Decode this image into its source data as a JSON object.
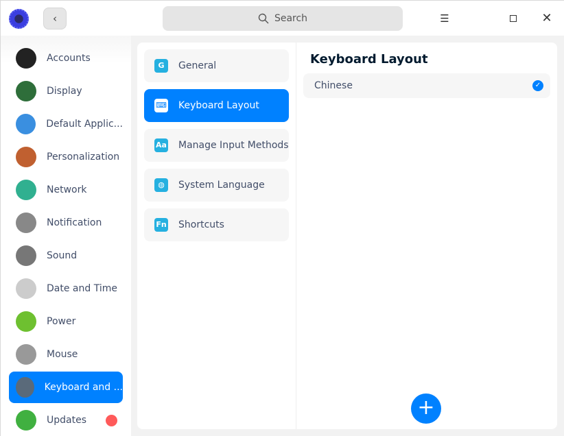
{
  "titlebar": {
    "search_placeholder": "Search",
    "back_icon": "chevron-left",
    "menu_icon": "hamburger",
    "minimize_icon": "minimize",
    "maximize_icon": "maximize",
    "close_icon": "close"
  },
  "sidebar": {
    "items": [
      {
        "label": "Accounts",
        "color": "#222222"
      },
      {
        "label": "Display",
        "color": "#2e6e3a"
      },
      {
        "label": "Default Applic...",
        "color": "#3a8fe0"
      },
      {
        "label": "Personalization",
        "color": "#c06030"
      },
      {
        "label": "Network",
        "color": "#30b090"
      },
      {
        "label": "Notification",
        "color": "#888888"
      },
      {
        "label": "Sound",
        "color": "#777777"
      },
      {
        "label": "Date and Time",
        "color": "#cccccc"
      },
      {
        "label": "Power",
        "color": "#6ec030"
      },
      {
        "label": "Mouse",
        "color": "#999999"
      },
      {
        "label": "Keyboard and ...",
        "color": "#5a6a7a",
        "active": true
      },
      {
        "label": "Updates",
        "color": "#40b040",
        "badge": true
      }
    ]
  },
  "menu": {
    "items": [
      {
        "label": "General",
        "icon": "G"
      },
      {
        "label": "Keyboard Layout",
        "icon": "⌨",
        "active": true
      },
      {
        "label": "Manage Input Methods",
        "icon": "Aa"
      },
      {
        "label": "System Language",
        "icon": "◍"
      },
      {
        "label": "Shortcuts",
        "icon": "Fn"
      }
    ]
  },
  "main": {
    "title": "Keyboard Layout",
    "layouts": [
      {
        "label": "Chinese",
        "selected": true
      }
    ],
    "add_label": "+"
  },
  "colors": {
    "accent": "#0081ff",
    "badge": "#ff5a5a"
  }
}
